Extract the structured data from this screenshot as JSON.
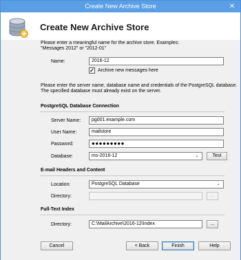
{
  "window": {
    "title": "Create New Archive Store",
    "close_glyph": "✕"
  },
  "header": {
    "heading": "Create New Archive Store",
    "icon": "database-icon"
  },
  "intro": {
    "line1": "Please enter a meaningful name for the archive store. Examples:",
    "line2": "\"Messages 2012\" or \"2012-01\""
  },
  "name_field": {
    "label": "Name:",
    "value": "2016-12"
  },
  "archive_checkbox": {
    "label": "Archive new messages here",
    "checked": true,
    "mark": "✓"
  },
  "db_intro": {
    "line1": "Please enter the server name, database name and credentials of the PostgreSQL database.",
    "line2": "The specified database must already exist on the server."
  },
  "db_section": {
    "title": "PostgreSQL Database Connection",
    "server_label": "Server Name:",
    "server_value": "pg001.example.com",
    "user_label": "User Name:",
    "user_value": "mailstore",
    "password_label": "Password:",
    "password_value": "●●●●●●●●●",
    "database_label": "Database:",
    "database_value": "ms-2016-12",
    "test_button": "Test"
  },
  "headers_section": {
    "title": "E-mail Headers and Content",
    "location_label": "Location:",
    "location_value": "PostgreSQL Database",
    "directory_label": "Directory:",
    "directory_value": "",
    "browse_button": "..."
  },
  "fulltext_section": {
    "title": "Full-Text Index",
    "directory_label": "Directory:",
    "directory_value": "C:\\MailArchive\\2016-12\\Index",
    "browse_button": "..."
  },
  "footer": {
    "cancel": "Cancel",
    "back": "< Back",
    "finish": "Finish",
    "help": "Help"
  },
  "dropdown_glyph": "⌄"
}
